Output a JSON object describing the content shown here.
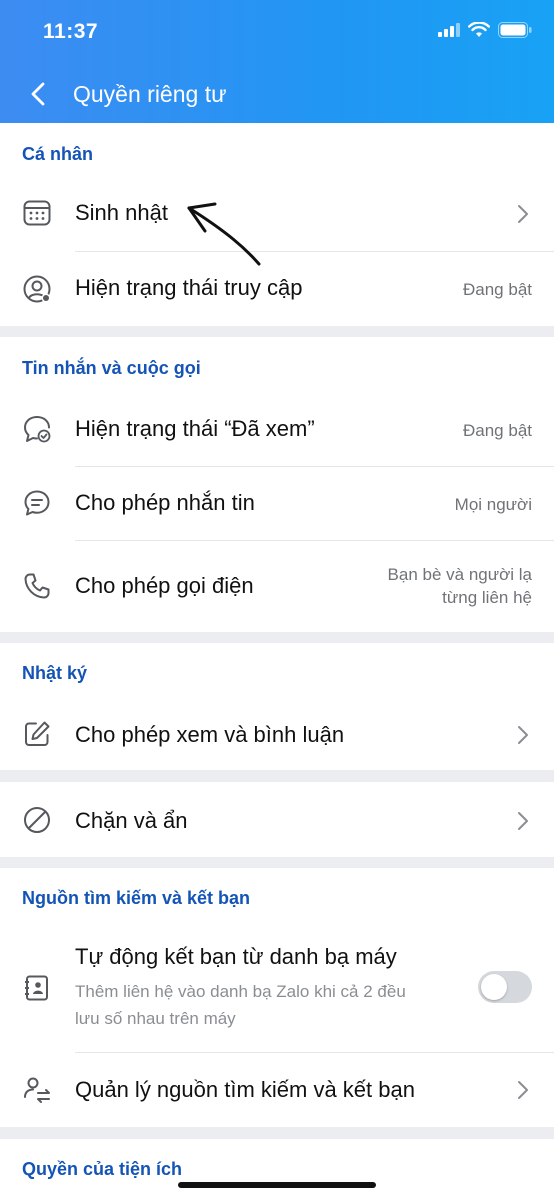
{
  "status_bar": {
    "time": "11:37"
  },
  "header": {
    "title": "Quyền riêng tư"
  },
  "sections": {
    "personal": {
      "title": "Cá nhân",
      "rows": [
        {
          "label": "Sinh nhật",
          "icon": "calendar-icon"
        },
        {
          "label": "Hiện trạng thái truy cập",
          "value": "Đang bật",
          "icon": "user-status-icon"
        }
      ]
    },
    "messages": {
      "title": "Tin nhắn và cuộc gọi",
      "rows": [
        {
          "label": "Hiện trạng thái “Đã xem”",
          "value": "Đang bật",
          "icon": "seen-chat-icon"
        },
        {
          "label": "Cho phép nhắn tin",
          "value": "Mọi người",
          "icon": "chat-bubble-icon"
        },
        {
          "label": "Cho phép gọi điện",
          "value_line1": "Bạn bè và người lạ",
          "value_line2": "từng liên hệ",
          "icon": "phone-icon"
        }
      ]
    },
    "diary": {
      "title": "Nhật ký",
      "rows": [
        {
          "label": "Cho phép xem và bình luận",
          "icon": "edit-icon"
        }
      ]
    },
    "block": {
      "rows": [
        {
          "label": "Chặn và ẩn",
          "icon": "block-icon"
        }
      ]
    },
    "sources": {
      "title": "Nguồn tìm kiếm và kết bạn",
      "rows": [
        {
          "label": "Tự động kết bạn từ danh bạ máy",
          "sublabel_line1": "Thêm liên hệ vào danh bạ Zalo khi cả 2 đều",
          "sublabel_line2": "lưu số nhau trên máy",
          "icon": "contacts-book-icon",
          "toggle_on": false
        },
        {
          "label": "Quản lý nguồn tìm kiếm và kết bạn",
          "icon": "user-sync-icon"
        }
      ]
    },
    "utilities": {
      "title": "Quyền của tiện ích"
    }
  },
  "colors": {
    "header_start": "#3d8cf2",
    "header_end": "#18a2f5",
    "section_title": "#1454b7",
    "background": "#ebedf0"
  }
}
